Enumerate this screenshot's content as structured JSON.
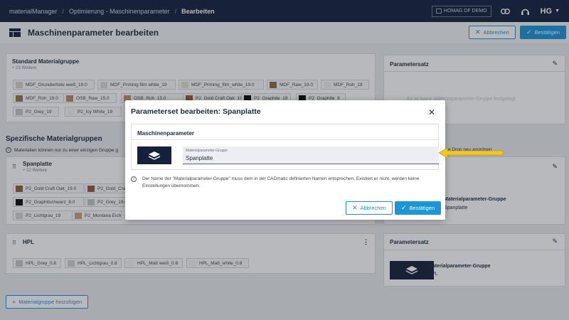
{
  "topbar": {
    "breadcrumbs": [
      "materialManager",
      "Optimierung - Maschinenparameter",
      "Bearbeiten"
    ],
    "tenant": "HOMAG DF DEMO",
    "icons": [
      "link-icon",
      "support-icon"
    ],
    "account": "HG"
  },
  "page": {
    "title": "Maschinenparameter bearbeiten",
    "cancel_label": "Abbrechen",
    "confirm_label": "Bestätigen"
  },
  "standard_group": {
    "title": "Standard Materialgruppe",
    "more": "+ 23 Weitere",
    "chips": [
      {
        "label": "MDF_Grundierfolie weiß_19.0",
        "color": "#d8d3cb"
      },
      {
        "label": "MDF_Priming film white_19",
        "color": "#dedad3"
      },
      {
        "label": "MDF_Priming_film_white_19.0",
        "color": "#e0ddd6"
      },
      {
        "label": "MDF_Raw_19.0",
        "color": "#8a6c4c"
      },
      {
        "label": "MDF_Roh_19",
        "color": "#efefef"
      },
      {
        "label": "MDF_Roh_19.0",
        "color": "#9a7352"
      },
      {
        "label": "OSB_Raw_15.0",
        "color": "#b88d5d"
      },
      {
        "label": "OSB_Roh_15.0",
        "color": "#c09566"
      },
      {
        "label": "P2_Gold Craft Oak_19",
        "color": "#8f5f36"
      },
      {
        "label": "P2_Graphite_19",
        "color": "#0a0a0a"
      },
      {
        "label": "P2_Graphite_8",
        "color": "#0a0a0a"
      },
      {
        "label": "P2_Grey_19",
        "color": "#c4c4c4"
      },
      {
        "label": "P2_Icy White_19",
        "color": "#f3f2ee"
      }
    ]
  },
  "specific_groups": {
    "title": "Spezifische Materialgruppen",
    "info": "Materialien können nur zu einer einzigen Gruppe g",
    "info_tail": "e Drop neu anordnen"
  },
  "spanplatte": {
    "title": "Spanplatte",
    "more": "+ 12 Weitere",
    "chips": [
      {
        "label": "P2_Gold Craft Oak_19.0",
        "color": "#8f5f36"
      },
      {
        "label": "P2_Gold_Cra",
        "color": "#8f5f36"
      },
      {
        "label": "P2_Graphitschwarz_8.0",
        "color": "#0a0a0a"
      },
      {
        "label": "P2_Grey_19.0",
        "color": "#c4c4c4"
      },
      {
        "label": "P2_Lichtgrau_19",
        "color": "#d3d3d3"
      },
      {
        "label": "P2_Montana Eiche N",
        "color": "#c9a37a"
      }
    ]
  },
  "hpl": {
    "title": "HPL",
    "chips": [
      {
        "label": "HPL_Grey_0.8",
        "color": "#c8c8c8"
      },
      {
        "label": "HPL_Lichtgrau_0.8",
        "color": "#d0d0d0"
      },
      {
        "label": "HPL_Matt weiß_0.8",
        "color": "#f3f3f3"
      },
      {
        "label": "HPL_Matt_white_0.8",
        "color": "#f3f3f3"
      }
    ]
  },
  "parameter_panels": {
    "title": "Parametersatz",
    "empty_text": "Es ist keine Materialparameter-Gruppe festgelegt.",
    "middle_label": "Materialparameter-Gruppe",
    "middle_value": "Spanplatte",
    "hpl_label": "Materialparameter-Gruppe",
    "hpl_value": "HPL"
  },
  "add_group_label": "Materialgruppe hinzufügen",
  "modal": {
    "title": "Parameterset bearbeiten: Spanplatte",
    "section_title": "Maschinenparameter",
    "field_label": "Materialparameter-Gruppe",
    "field_value": "Spanplatte",
    "info_text": "Der Name der \"Materialparameter-Gruppe\" muss dem in der CADmatic definierten Namen entsprechen. Existiert er nicht, werden keine Einstellungen übernommen.",
    "cancel_label": "Abbrechen",
    "confirm_label": "Bestätigen"
  },
  "colors": {
    "navy": "#14213d",
    "accent": "#1c96d6",
    "arrow": "#f5c518"
  }
}
